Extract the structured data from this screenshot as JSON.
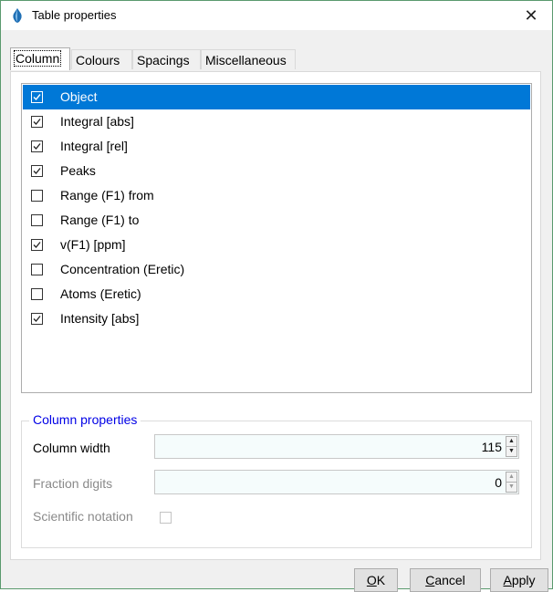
{
  "window": {
    "title": "Table properties",
    "close_glyph": "✕",
    "app_icon": "app-logo-icon"
  },
  "tabs": [
    {
      "label": "Column",
      "active": true
    },
    {
      "label": "Colours",
      "active": false
    },
    {
      "label": "Spacings",
      "active": false
    },
    {
      "label": "Miscellaneous",
      "active": false
    }
  ],
  "columns": [
    {
      "label": "Object",
      "checked": true,
      "selected": true
    },
    {
      "label": "Integral [abs]",
      "checked": true,
      "selected": false
    },
    {
      "label": "Integral [rel]",
      "checked": true,
      "selected": false
    },
    {
      "label": "Peaks",
      "checked": true,
      "selected": false
    },
    {
      "label": "Range (F1) from",
      "checked": false,
      "selected": false
    },
    {
      "label": "Range (F1) to",
      "checked": false,
      "selected": false
    },
    {
      "label": "v(F1) [ppm]",
      "checked": true,
      "selected": false
    },
    {
      "label": "Concentration (Eretic)",
      "checked": false,
      "selected": false
    },
    {
      "label": "Atoms (Eretic)",
      "checked": false,
      "selected": false
    },
    {
      "label": "Intensity [abs]",
      "checked": true,
      "selected": false
    }
  ],
  "column_properties": {
    "title": "Column properties",
    "column_width": {
      "label": "Column width",
      "value": "115"
    },
    "fraction_digits": {
      "label": "Fraction digits",
      "value": "0"
    },
    "scientific_notation": {
      "label": "Scientific notation",
      "checked": false
    }
  },
  "buttons": {
    "ok": {
      "mnemonic": "O",
      "rest": "K"
    },
    "cancel": {
      "mnemonic": "C",
      "rest": "ancel"
    },
    "apply": {
      "mnemonic": "A",
      "rest": "pply"
    }
  },
  "colors": {
    "selection": "#0078d7",
    "group_title": "#0000e6",
    "window_border": "#5a9a6e"
  }
}
